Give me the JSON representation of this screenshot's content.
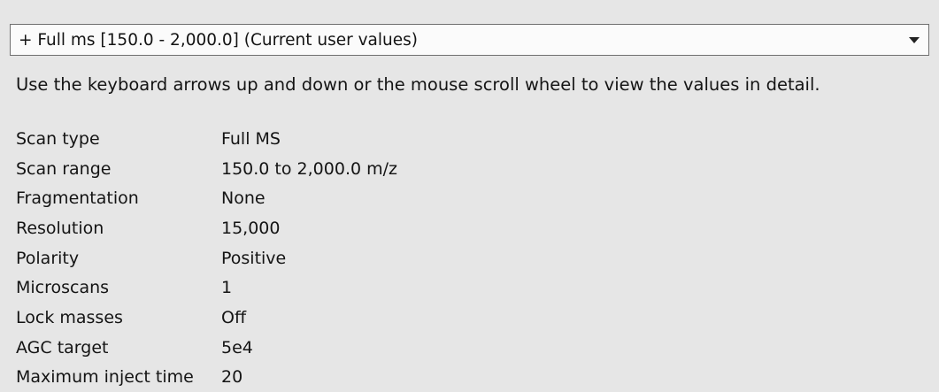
{
  "dropdown": {
    "selected": "+ Full ms [150.0 - 2,000.0]  (Current user values)",
    "arrow_icon": "chevron-down-icon"
  },
  "instruction": "Use the keyboard arrows up and down or the mouse scroll wheel to view the values in detail.",
  "params": [
    {
      "label": "Scan type",
      "value": "Full MS"
    },
    {
      "label": "Scan range",
      "value": "150.0 to 2,000.0 m/z"
    },
    {
      "label": "Fragmentation",
      "value": "None"
    },
    {
      "label": "Resolution",
      "value": "15,000"
    },
    {
      "label": "Polarity",
      "value": "Positive"
    },
    {
      "label": "Microscans",
      "value": "1"
    },
    {
      "label": "Lock masses",
      "value": "Off"
    },
    {
      "label": "AGC target",
      "value": "5e4"
    },
    {
      "label": "Maximum inject time",
      "value": "20"
    }
  ]
}
